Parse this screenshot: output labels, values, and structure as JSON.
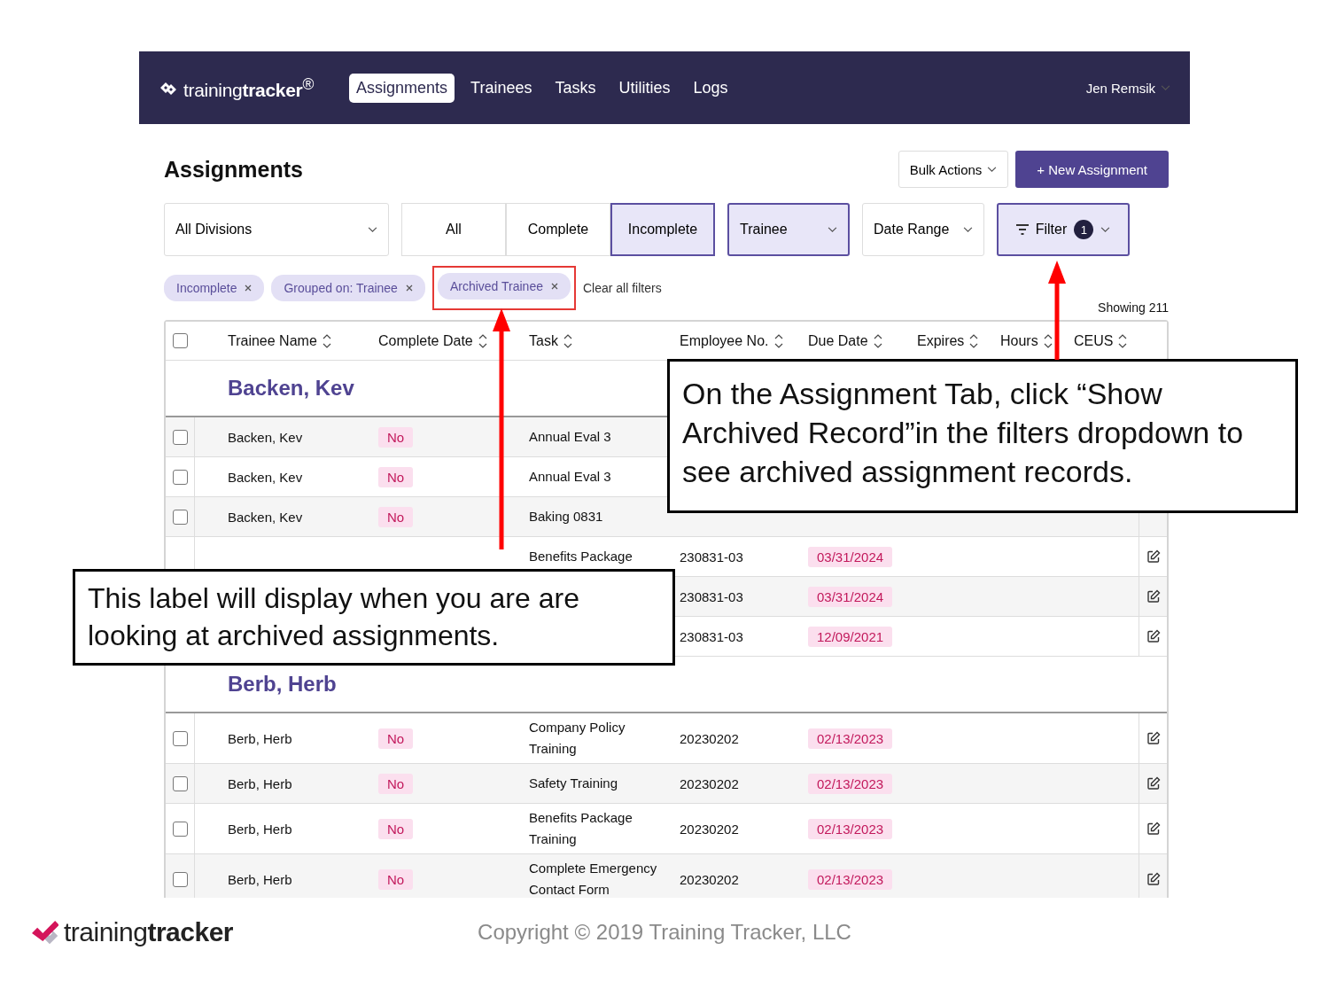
{
  "nav": {
    "logo": "training**tracker**$^{®}$",
    "tabs": [
      {
        "label": "Assignments",
        "selected": true
      },
      {
        "label": "Trainees",
        "selected": false
      },
      {
        "label": "Tasks",
        "selected": false
      },
      {
        "label": "Utilities",
        "selected": false
      },
      {
        "label": "Logs",
        "selected": false
      }
    ],
    "user": "Jen Remsik"
  },
  "header": {
    "title": "Assignments",
    "bulk_actions": "Bulk Actions",
    "new_assignment": "+ New Assignment"
  },
  "filters": {
    "division": "All Divisions",
    "status_tabs": [
      {
        "label": "All",
        "selected": false
      },
      {
        "label": "Complete",
        "selected": false
      },
      {
        "label": "Incomplete",
        "selected": true
      }
    ],
    "group_by": "Trainee",
    "date_range": "Date Range",
    "filter": {
      "label": "Filter",
      "count": "1"
    }
  },
  "chips": [
    {
      "label": "Incomplete",
      "highlighted": false
    },
    {
      "label": "Grouped on: Trainee",
      "highlighted": false
    },
    {
      "label": "Archived Trainee",
      "highlighted": true
    }
  ],
  "clear_all": "Clear all filters",
  "showing": "Showing 211",
  "table": {
    "select_all_checked": false,
    "columns": [
      "Trainee Name",
      "Complete Date",
      "Task",
      "Employee No.",
      "Due Date",
      "Expires",
      "Hours",
      "CEUS"
    ],
    "groups": [
      {
        "name": "Backen, Kev",
        "rows": [
          {
            "checked": false,
            "trainee": "Backen, Kev",
            "complete": "No",
            "task": "Annual Eval 3"
          },
          {
            "checked": false,
            "trainee": "Backen, Kev",
            "complete": "No",
            "task": "Annual Eval 3"
          },
          {
            "checked": false,
            "trainee": "Backen, Kev",
            "complete": "No",
            "task": "Baking 0831"
          },
          {
            "task": "Benefits Package",
            "employee_no": "230831-03",
            "due_date": "03/31/2024"
          },
          {
            "employee_no": "230831-03",
            "due_date": "03/31/2024"
          },
          {
            "employee_no": "230831-03",
            "due_date": "12/09/2021"
          }
        ]
      },
      {
        "name": "Berb, Herb",
        "rows": [
          {
            "checked": false,
            "trainee": "Berb, Herb",
            "complete": "No",
            "task": "Company Policy Training",
            "employee_no": "20230202",
            "due_date": "02/13/2023"
          },
          {
            "checked": false,
            "trainee": "Berb, Herb",
            "complete": "No",
            "task": "Safety Training",
            "employee_no": "20230202",
            "due_date": "02/13/2023"
          },
          {
            "checked": false,
            "trainee": "Berb, Herb",
            "complete": "No",
            "task": "Benefits Package Training",
            "employee_no": "20230202",
            "due_date": "02/13/2023"
          },
          {
            "checked": false,
            "trainee": "Berb, Herb",
            "complete": "No",
            "task": "Complete Emergency Contact Form",
            "employee_no": "20230202",
            "due_date": "02/13/2023"
          }
        ]
      }
    ]
  },
  "callouts": [
    {
      "text": "On the Assignment Tab, click “Show Archived Record”in the filters dropdown to see archived assignment records."
    },
    {
      "text": "This label will display when you are are looking at archived assignments."
    }
  ],
  "footer": {
    "logo": "training**tracker**",
    "copyright": "Copyright © 2019 Training Tracker, LLC"
  }
}
